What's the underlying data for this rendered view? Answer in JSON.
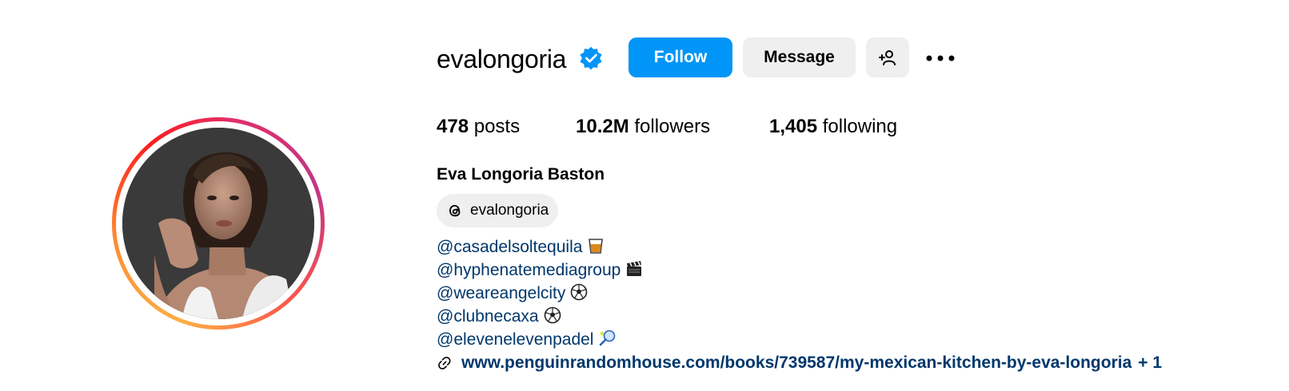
{
  "profile": {
    "username": "evalongoria",
    "verified_icon": "verified-badge-icon",
    "full_name": "Eva Longoria Baston",
    "threads_handle": "evalongoria"
  },
  "actions": {
    "follow_label": "Follow",
    "message_label": "Message",
    "add_user_icon": "add-person-icon",
    "more_icon": "more-options-icon"
  },
  "stats": {
    "posts_count": "478",
    "posts_label": "posts",
    "followers_count": "10.2M",
    "followers_label": "followers",
    "following_count": "1,405",
    "following_label": "following"
  },
  "bio": {
    "lines": [
      {
        "text": "@casadelsoltequila",
        "emoji": "tumbler-glass-icon"
      },
      {
        "text": "@hyphenatemediagroup",
        "emoji": "clapper-board-icon"
      },
      {
        "text": "@weareangelcity",
        "emoji": "soccer-ball-icon"
      },
      {
        "text": "@clubnecaxa",
        "emoji": "soccer-ball-icon"
      },
      {
        "text": "@elevenelevenpadel",
        "emoji": "padel-racket-icon"
      }
    ],
    "link_text": "www.penguinrandomhouse.com/books/739587/my-mexican-kitchen-by-eva-longoria",
    "link_extra": "+ 1"
  },
  "colors": {
    "follow_button": "#0095f6",
    "secondary_button": "#efefef",
    "link": "#00376b",
    "verified": "#0095f6"
  }
}
